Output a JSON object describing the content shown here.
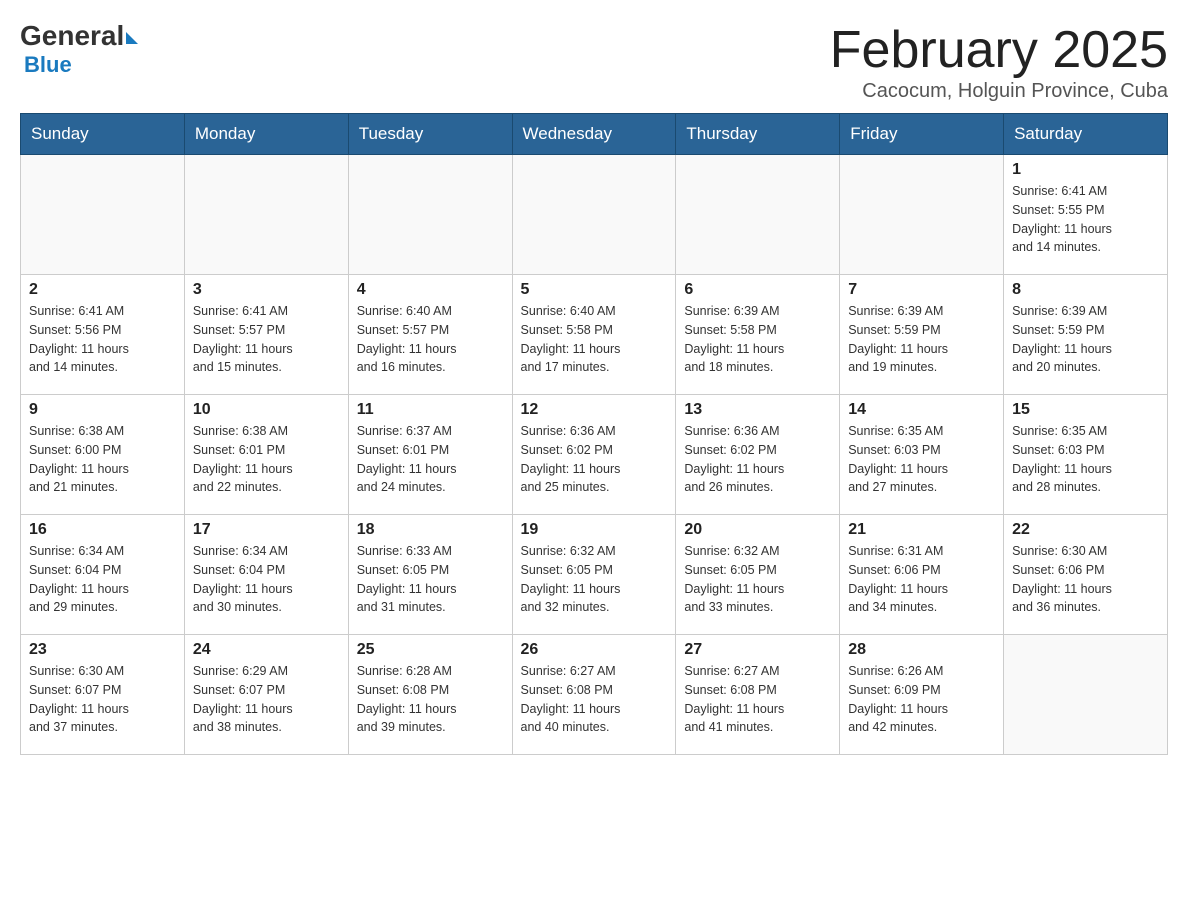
{
  "header": {
    "logo": {
      "general": "General",
      "blue": "Blue"
    },
    "title": "February 2025",
    "location": "Cacocum, Holguin Province, Cuba"
  },
  "days_of_week": [
    "Sunday",
    "Monday",
    "Tuesday",
    "Wednesday",
    "Thursday",
    "Friday",
    "Saturday"
  ],
  "weeks": [
    [
      {
        "day": "",
        "info": ""
      },
      {
        "day": "",
        "info": ""
      },
      {
        "day": "",
        "info": ""
      },
      {
        "day": "",
        "info": ""
      },
      {
        "day": "",
        "info": ""
      },
      {
        "day": "",
        "info": ""
      },
      {
        "day": "1",
        "info": "Sunrise: 6:41 AM\nSunset: 5:55 PM\nDaylight: 11 hours\nand 14 minutes."
      }
    ],
    [
      {
        "day": "2",
        "info": "Sunrise: 6:41 AM\nSunset: 5:56 PM\nDaylight: 11 hours\nand 14 minutes."
      },
      {
        "day": "3",
        "info": "Sunrise: 6:41 AM\nSunset: 5:57 PM\nDaylight: 11 hours\nand 15 minutes."
      },
      {
        "day": "4",
        "info": "Sunrise: 6:40 AM\nSunset: 5:57 PM\nDaylight: 11 hours\nand 16 minutes."
      },
      {
        "day": "5",
        "info": "Sunrise: 6:40 AM\nSunset: 5:58 PM\nDaylight: 11 hours\nand 17 minutes."
      },
      {
        "day": "6",
        "info": "Sunrise: 6:39 AM\nSunset: 5:58 PM\nDaylight: 11 hours\nand 18 minutes."
      },
      {
        "day": "7",
        "info": "Sunrise: 6:39 AM\nSunset: 5:59 PM\nDaylight: 11 hours\nand 19 minutes."
      },
      {
        "day": "8",
        "info": "Sunrise: 6:39 AM\nSunset: 5:59 PM\nDaylight: 11 hours\nand 20 minutes."
      }
    ],
    [
      {
        "day": "9",
        "info": "Sunrise: 6:38 AM\nSunset: 6:00 PM\nDaylight: 11 hours\nand 21 minutes."
      },
      {
        "day": "10",
        "info": "Sunrise: 6:38 AM\nSunset: 6:01 PM\nDaylight: 11 hours\nand 22 minutes."
      },
      {
        "day": "11",
        "info": "Sunrise: 6:37 AM\nSunset: 6:01 PM\nDaylight: 11 hours\nand 24 minutes."
      },
      {
        "day": "12",
        "info": "Sunrise: 6:36 AM\nSunset: 6:02 PM\nDaylight: 11 hours\nand 25 minutes."
      },
      {
        "day": "13",
        "info": "Sunrise: 6:36 AM\nSunset: 6:02 PM\nDaylight: 11 hours\nand 26 minutes."
      },
      {
        "day": "14",
        "info": "Sunrise: 6:35 AM\nSunset: 6:03 PM\nDaylight: 11 hours\nand 27 minutes."
      },
      {
        "day": "15",
        "info": "Sunrise: 6:35 AM\nSunset: 6:03 PM\nDaylight: 11 hours\nand 28 minutes."
      }
    ],
    [
      {
        "day": "16",
        "info": "Sunrise: 6:34 AM\nSunset: 6:04 PM\nDaylight: 11 hours\nand 29 minutes."
      },
      {
        "day": "17",
        "info": "Sunrise: 6:34 AM\nSunset: 6:04 PM\nDaylight: 11 hours\nand 30 minutes."
      },
      {
        "day": "18",
        "info": "Sunrise: 6:33 AM\nSunset: 6:05 PM\nDaylight: 11 hours\nand 31 minutes."
      },
      {
        "day": "19",
        "info": "Sunrise: 6:32 AM\nSunset: 6:05 PM\nDaylight: 11 hours\nand 32 minutes."
      },
      {
        "day": "20",
        "info": "Sunrise: 6:32 AM\nSunset: 6:05 PM\nDaylight: 11 hours\nand 33 minutes."
      },
      {
        "day": "21",
        "info": "Sunrise: 6:31 AM\nSunset: 6:06 PM\nDaylight: 11 hours\nand 34 minutes."
      },
      {
        "day": "22",
        "info": "Sunrise: 6:30 AM\nSunset: 6:06 PM\nDaylight: 11 hours\nand 36 minutes."
      }
    ],
    [
      {
        "day": "23",
        "info": "Sunrise: 6:30 AM\nSunset: 6:07 PM\nDaylight: 11 hours\nand 37 minutes."
      },
      {
        "day": "24",
        "info": "Sunrise: 6:29 AM\nSunset: 6:07 PM\nDaylight: 11 hours\nand 38 minutes."
      },
      {
        "day": "25",
        "info": "Sunrise: 6:28 AM\nSunset: 6:08 PM\nDaylight: 11 hours\nand 39 minutes."
      },
      {
        "day": "26",
        "info": "Sunrise: 6:27 AM\nSunset: 6:08 PM\nDaylight: 11 hours\nand 40 minutes."
      },
      {
        "day": "27",
        "info": "Sunrise: 6:27 AM\nSunset: 6:08 PM\nDaylight: 11 hours\nand 41 minutes."
      },
      {
        "day": "28",
        "info": "Sunrise: 6:26 AM\nSunset: 6:09 PM\nDaylight: 11 hours\nand 42 minutes."
      },
      {
        "day": "",
        "info": ""
      }
    ]
  ]
}
